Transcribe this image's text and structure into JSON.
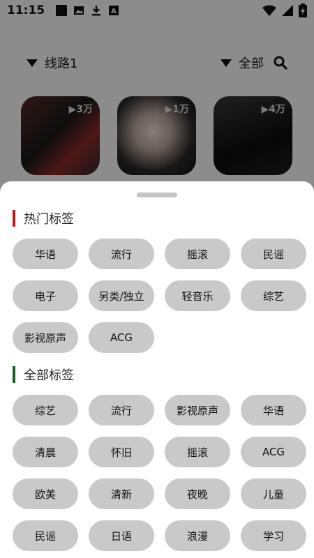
{
  "status_bar": {
    "time": "11:15",
    "icons": [
      "notification-square-icon",
      "image-icon",
      "download-icon",
      "app-a-icon"
    ],
    "right_icons": [
      "wifi-icon",
      "signal-icon",
      "battery-icon"
    ]
  },
  "top_bar": {
    "route_label": "线路1",
    "filter_label": "全部"
  },
  "albums": [
    {
      "play_count": "▶3万"
    },
    {
      "play_count": "▶1万"
    },
    {
      "play_count": "▶4万"
    }
  ],
  "sheet": {
    "hot": {
      "title": "热门标签",
      "accent": "#b71c1c",
      "tags": [
        "华语",
        "流行",
        "摇滚",
        "民谣",
        "电子",
        "另类/独立",
        "轻音乐",
        "综艺",
        "影视原声",
        "ACG"
      ]
    },
    "all": {
      "title": "全部标签",
      "accent": "#1b5e20",
      "tags": [
        "综艺",
        "流行",
        "影视原声",
        "华语",
        "清晨",
        "怀旧",
        "摇滚",
        "ACG",
        "欧美",
        "清新",
        "夜晚",
        "儿童",
        "民谣",
        "日语",
        "浪漫",
        "学习"
      ]
    }
  }
}
